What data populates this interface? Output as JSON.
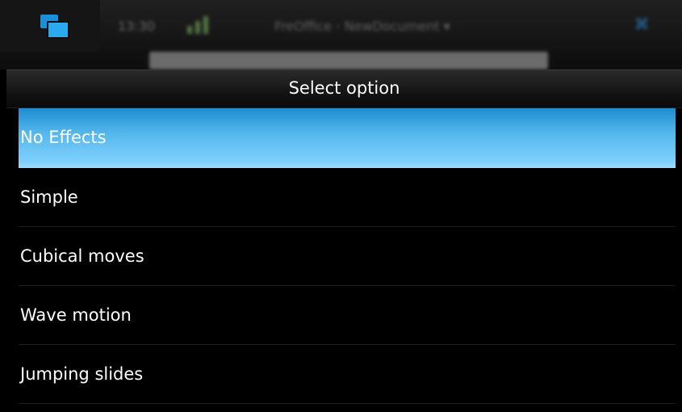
{
  "status_bar": {
    "clock": "13:30",
    "title": "FreOffice - NewDocument ▾",
    "close_symbol": "✖"
  },
  "dialog": {
    "title": "Select option",
    "options": [
      {
        "label": "No Effects",
        "selected": true
      },
      {
        "label": "Simple",
        "selected": false
      },
      {
        "label": "Cubical moves",
        "selected": false
      },
      {
        "label": "Wave motion",
        "selected": false
      },
      {
        "label": "Jumping slides",
        "selected": false
      }
    ]
  },
  "colors": {
    "selection_top": "#1e8bd0",
    "selection_bottom": "#a0dcff",
    "switcher_icon": "#2aa9ee",
    "text": "#ffffff"
  },
  "icons": {
    "task_switcher": "task-switcher-icon",
    "signal": "signal-icon",
    "close": "close-icon"
  }
}
